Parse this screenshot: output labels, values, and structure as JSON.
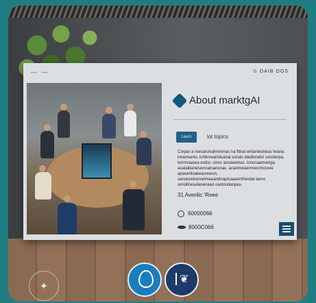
{
  "board": {
    "menu_label": "—  ―",
    "status_text": "⊙ OAIB OOS",
    "about_title": "About marktgAI",
    "tag_button": "Learn",
    "tag_label": "lol topics",
    "description": "Corpar a roesarolvahrenmas ha fitnal wntaniedneas twana mrannanto, tvhbrveanidsanal sondo otedlonelst sondenpa. tormnaasea eodsr, sinvs avoaeomas. lononaamaniga aoalaldaneluoncalnansnau. acaotnwaemnecrmouvie apaoenloakeasnoesn, sanoeselrannelmeaandnaplcaaaontfoiodal tanro sriroilineselanenaeo oanlondanpas.",
    "address": "31 Avenlic 'Reee",
    "phone": "60000066",
    "fax": "8000C066"
  },
  "icons": {
    "logo": "diamond-logo-icon",
    "phone": "phone-icon",
    "fax": "fax-icon",
    "menu": "hamburger-menu-icon",
    "social_1": "location-pin-icon",
    "social_2": "twitter-bird-icon",
    "badge": "sparkle-badge-icon"
  },
  "colors": {
    "accent": "#245f8c",
    "background": "#1f7d82",
    "social_1": "#1a7dbd",
    "social_2": "#1e3a68"
  }
}
